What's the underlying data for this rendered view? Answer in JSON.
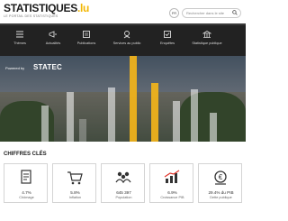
{
  "header": {
    "logo_main": "STATISTIQUES",
    "logo_lu": ".lu",
    "tagline": "LE PORTAIL DES STATISTIQUES",
    "lang": "FR",
    "search_placeholder": "Rechercher dans le site"
  },
  "nav": {
    "items": [
      {
        "label": "Thèmes",
        "icon": "list-icon"
      },
      {
        "label": "Actualités",
        "icon": "megaphone-icon"
      },
      {
        "label": "Publications",
        "icon": "book-icon"
      },
      {
        "label": "Services au public",
        "icon": "service-icon"
      },
      {
        "label": "Enquêtes",
        "icon": "survey-icon"
      },
      {
        "label": "Statistique publique",
        "icon": "institution-icon"
      }
    ]
  },
  "hero": {
    "powered_by": "Powered by",
    "brand": "STATEC"
  },
  "key_figures": {
    "title": "CHIFFRES CLÉS",
    "cards": [
      {
        "value": "4.7%",
        "label": "Chômage",
        "icon": "document-icon"
      },
      {
        "value": "5.8%",
        "label": "Inflation",
        "icon": "cart-icon"
      },
      {
        "value": "645 397",
        "label": "Population",
        "icon": "people-icon"
      },
      {
        "value": "6.9%",
        "label": "Croissance PIB",
        "icon": "growth-chart-icon"
      },
      {
        "value": "29.4% du PIB",
        "label": "Dette publique",
        "icon": "debt-icon"
      }
    ]
  },
  "colors": {
    "accent": "#f3b41a",
    "nav_bg": "#222222"
  }
}
